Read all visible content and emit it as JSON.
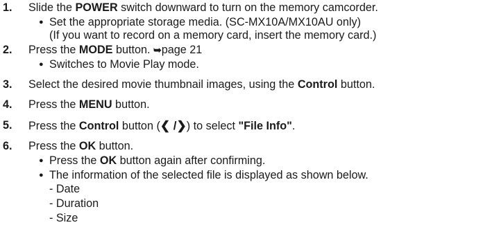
{
  "top_fragment": "Slide the POWER switch downward to turn on the memory camcorder",
  "steps": [
    {
      "num": "1.",
      "pre": "Slide the ",
      "bold": "POWER",
      "post": " switch downward to turn on the memory camcorder.",
      "bullets": [
        {
          "text": "Set the appropriate storage media. (SC-MX10A/MX10AU only)"
        },
        {
          "text": "(If you want to record on a memory card, insert the memory card.)"
        }
      ]
    },
    {
      "num": "2.",
      "pre": "Press the ",
      "bold": "MODE",
      "post": " button. ",
      "arrow": "➥",
      "page": "page 21",
      "bullets": [
        {
          "text": "Switches to Movie Play mode."
        }
      ]
    },
    {
      "num": "3.",
      "pre": "Select the desired movie thumbnail images, using the ",
      "bold": "Control",
      "post": " button."
    },
    {
      "num": "4.",
      "pre": "Press the ",
      "bold": "MENU",
      "post": " button."
    },
    {
      "num": "5.",
      "pre": "Press the ",
      "bold": "Control",
      "mid": " button (",
      "chevrons": "❮ /❯",
      "mid2": ") to select ",
      "bold2": "\"File Info\"",
      "post": "."
    },
    {
      "num": "6.",
      "pre": "Press the ",
      "bold": "OK",
      "post": " button.",
      "bullets": [
        {
          "pre": "Press the ",
          "bold": "OK",
          "post": " button again after confirming."
        },
        {
          "text": "The information of the selected file is displayed as shown below."
        }
      ],
      "dashes": [
        "- Date",
        "- Duration",
        "- Size"
      ]
    }
  ]
}
